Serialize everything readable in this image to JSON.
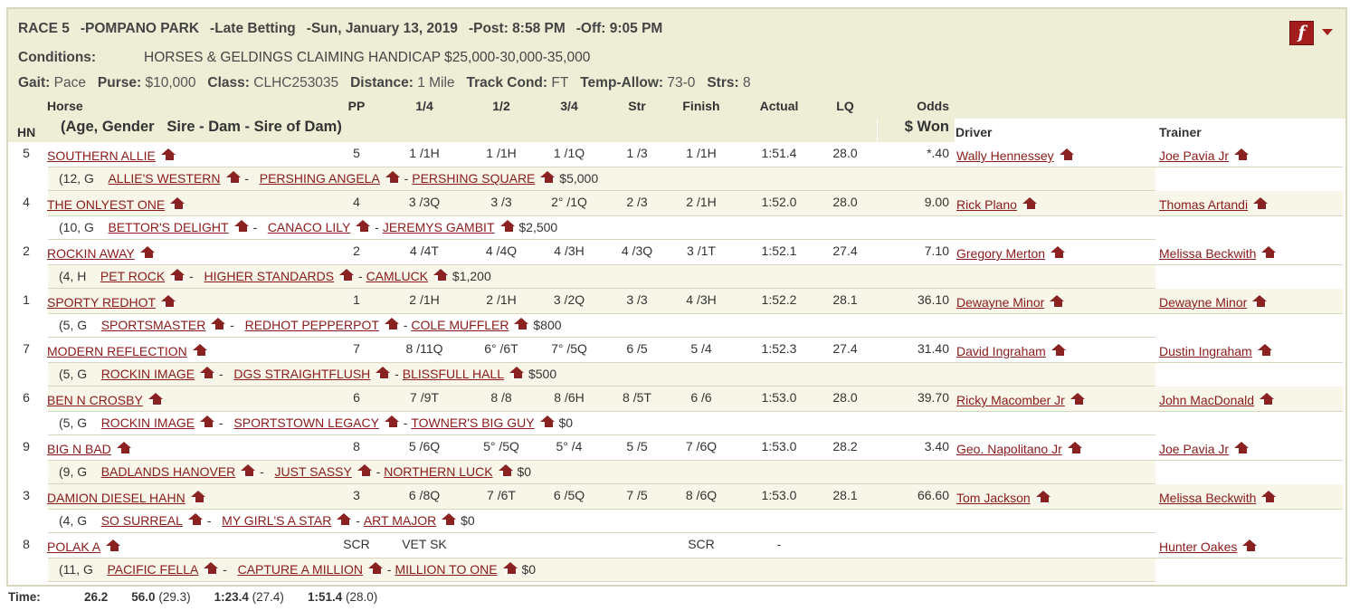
{
  "header": {
    "line1": [
      "RACE 5",
      "POMPANO PARK",
      "Late Betting",
      "Sun, January 13, 2019",
      "Post: 8:58 PM",
      "Off: 9:05 PM"
    ],
    "separator": "-",
    "conditions_label": "Conditions:",
    "conditions_value": "HORSES & GELDINGS CLAIMING HANDICAP $25,000-30,000-35,000",
    "fields": [
      {
        "label": "Gait:",
        "value": "Pace"
      },
      {
        "label": "Purse:",
        "value": "$10,000"
      },
      {
        "label": "Class:",
        "value": "CLHC253035"
      },
      {
        "label": "Distance:",
        "value": "1 Mile"
      },
      {
        "label": "Track Cond:",
        "value": "FT"
      },
      {
        "label": "Temp-Allow:",
        "value": "73-0"
      },
      {
        "label": "Strs:",
        "value": "8"
      }
    ],
    "flash_glyph": "f"
  },
  "columns": {
    "hn": "HN",
    "horse": "Horse",
    "horse_sub": "(Age, Gender   Sire - Dam - Sire of Dam)",
    "pp": "PP",
    "q1": "1/4",
    "q2": "1/2",
    "q3": "3/4",
    "str": "Str",
    "finish": "Finish",
    "actual": "Actual",
    "lq": "LQ",
    "odds": "Odds",
    "won": "$ Won",
    "driver": "Driver",
    "trainer": "Trainer"
  },
  "rows": [
    {
      "hn": "5",
      "horse": "SOUTHERN ALLIE",
      "pp": "5",
      "q1": "1 /1H",
      "q2": "1 /1H",
      "q3": "1 /1Q",
      "str": "1 /3",
      "finish": "1 /1H",
      "actual": "1:51.4",
      "lq": "28.0",
      "odds": "*.40",
      "driver": "Wally Hennessey",
      "trainer": "Joe Pavia Jr",
      "age": "(12, G",
      "sire": "ALLIE'S WESTERN",
      "dam": "PERSHING ANGELA",
      "damsire": "PERSHING SQUARE",
      "won": "$5,000"
    },
    {
      "hn": "4",
      "horse": "THE ONLYEST ONE",
      "pp": "4",
      "q1": "3 /3Q",
      "q2": "3 /3",
      "q3": "2° /1Q",
      "str": "2 /3",
      "finish": "2 /1H",
      "actual": "1:52.0",
      "lq": "28.0",
      "odds": "9.00",
      "driver": "Rick Plano",
      "trainer": "Thomas Artandi",
      "age": "(10, G",
      "sire": "BETTOR'S DELIGHT",
      "dam": "CANACO LILY",
      "damsire": "JEREMYS GAMBIT",
      "won": "$2,500"
    },
    {
      "hn": "2",
      "horse": "ROCKIN AWAY",
      "pp": "2",
      "q1": "4 /4T",
      "q2": "4 /4Q",
      "q3": "4 /3H",
      "str": "4 /3Q",
      "finish": "3 /1T",
      "actual": "1:52.1",
      "lq": "27.4",
      "odds": "7.10",
      "driver": "Gregory Merton",
      "trainer": "Melissa Beckwith",
      "age": "(4, H",
      "sire": "PET ROCK",
      "dam": "HIGHER STANDARDS",
      "damsire": "CAMLUCK",
      "won": "$1,200"
    },
    {
      "hn": "1",
      "horse": "SPORTY REDHOT",
      "pp": "1",
      "q1": "2 /1H",
      "q2": "2 /1H",
      "q3": "3 /2Q",
      "str": "3 /3",
      "finish": "4 /3H",
      "actual": "1:52.2",
      "lq": "28.1",
      "odds": "36.10",
      "driver": "Dewayne Minor",
      "trainer": "Dewayne Minor",
      "age": "(5, G",
      "sire": "SPORTSMASTER",
      "dam": "REDHOT PEPPERPOT",
      "damsire": "COLE MUFFLER",
      "won": "$800"
    },
    {
      "hn": "7",
      "horse": "MODERN REFLECTION",
      "pp": "7",
      "q1": "8 /11Q",
      "q2": "6° /6T",
      "q3": "7° /5Q",
      "str": "6 /5",
      "finish": "5 /4",
      "actual": "1:52.3",
      "lq": "27.4",
      "odds": "31.40",
      "driver": "David Ingraham",
      "trainer": "Dustin Ingraham",
      "age": "(5, G",
      "sire": "ROCKIN IMAGE",
      "dam": "DGS STRAIGHTFLUSH",
      "damsire": "BLISSFULL HALL",
      "won": "$500"
    },
    {
      "hn": "6",
      "horse": "BEN N CROSBY",
      "pp": "6",
      "q1": "7 /9T",
      "q2": "8 /8",
      "q3": "8 /6H",
      "str": "8 /5T",
      "finish": "6 /6",
      "actual": "1:53.0",
      "lq": "28.0",
      "odds": "39.70",
      "driver": "Ricky Macomber Jr",
      "trainer": "John MacDonald",
      "age": "(5, G",
      "sire": "ROCKIN IMAGE",
      "dam": "SPORTSTOWN LEGACY",
      "damsire": "TOWNER'S BIG GUY",
      "won": "$0"
    },
    {
      "hn": "9",
      "horse": "BIG N BAD",
      "pp": "8",
      "q1": "5 /6Q",
      "q2": "5° /5Q",
      "q3": "5° /4",
      "str": "5 /5",
      "finish": "7 /6Q",
      "actual": "1:53.0",
      "lq": "28.2",
      "odds": "3.40",
      "driver": "Geo. Napolitano Jr",
      "trainer": "Joe Pavia Jr",
      "age": "(9, G",
      "sire": "BADLANDS HANOVER",
      "dam": "JUST SASSY",
      "damsire": "NORTHERN LUCK",
      "won": "$0"
    },
    {
      "hn": "3",
      "horse": "DAMION DIESEL HAHN",
      "pp": "3",
      "q1": "6 /8Q",
      "q2": "7 /6T",
      "q3": "6 /5Q",
      "str": "7 /5",
      "finish": "8 /6Q",
      "actual": "1:53.0",
      "lq": "28.1",
      "odds": "66.60",
      "driver": "Tom Jackson",
      "trainer": "Melissa Beckwith",
      "age": "(4, G",
      "sire": "SO SURREAL",
      "dam": "MY GIRL'S A STAR",
      "damsire": "ART MAJOR",
      "won": "$0"
    },
    {
      "hn": "8",
      "horse": "POLAK A",
      "pp": "SCR",
      "q1": "VET SK",
      "q2": "",
      "q3": "",
      "str": "",
      "finish": "SCR",
      "actual": "-",
      "lq": "",
      "odds": "",
      "driver": "",
      "trainer": "Hunter Oakes",
      "age": "(11, G",
      "sire": "PACIFIC FELLA",
      "dam": "CAPTURE A MILLION",
      "damsire": "MILLION TO ONE",
      "won": "$0"
    }
  ],
  "footer": {
    "label": "Time:",
    "splits": [
      {
        "t": "26.2",
        "q": ""
      },
      {
        "t": "56.0",
        "q": "(29.3)"
      },
      {
        "t": "1:23.4",
        "q": "(27.4)"
      },
      {
        "t": "1:51.4",
        "q": "(28.0)"
      }
    ]
  },
  "colors": {
    "header_bg": "#eeedd6",
    "link": "#8b1a1a",
    "icon": "#8b2222"
  }
}
